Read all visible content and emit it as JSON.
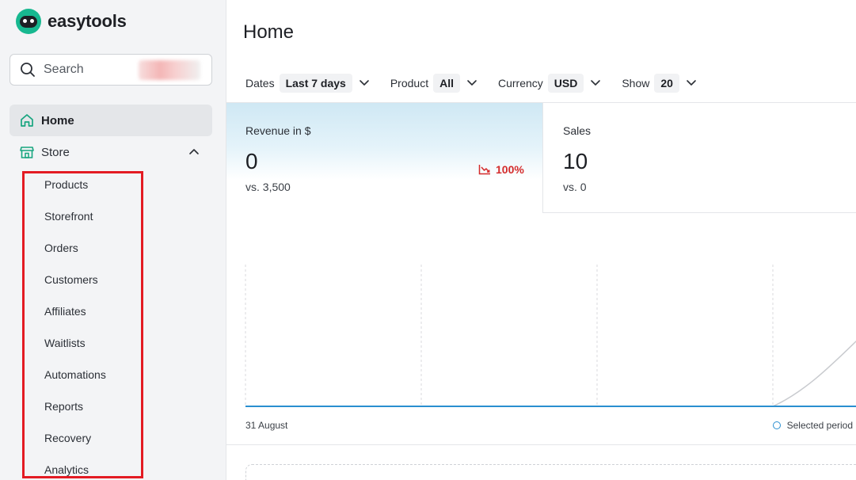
{
  "app": {
    "brand_name": "easytools"
  },
  "sidebar": {
    "search_placeholder": "Search",
    "home_label": "Home",
    "store_label": "Store",
    "store_items": [
      "Products",
      "Storefront",
      "Orders",
      "Customers",
      "Affiliates",
      "Waitlists",
      "Automations",
      "Reports",
      "Recovery",
      "Analytics"
    ]
  },
  "main": {
    "title": "Home",
    "filters": [
      {
        "label": "Dates",
        "value": "Last 7 days"
      },
      {
        "label": "Product",
        "value": "All"
      },
      {
        "label": "Currency",
        "value": "USD"
      },
      {
        "label": "Show",
        "value": "20"
      }
    ],
    "revenue": {
      "title": "Revenue in $",
      "value": "0",
      "compare": "vs. 3,500",
      "change": "100%"
    },
    "sales": {
      "title": "Sales",
      "value": "10",
      "compare": "vs. 0"
    },
    "chart": {
      "x_start_label": "31 August",
      "legend_label": "Selected period"
    }
  },
  "colors": {
    "accent": "#2a8fd0",
    "negative": "#d42b2b",
    "brand": "#17b890",
    "highlight_border": "#e31b23"
  }
}
